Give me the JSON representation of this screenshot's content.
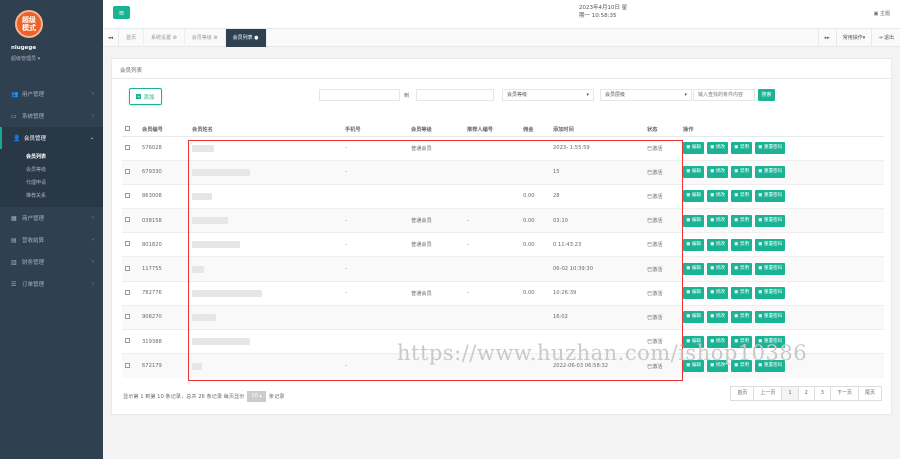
{
  "sidebar": {
    "logo_text": "超级\n模式",
    "user_name": "nlugege",
    "user_role": "超级管理员",
    "items": [
      {
        "icon": "users-icon",
        "glyph": "👥",
        "label": "用户管理"
      },
      {
        "icon": "monitor-icon",
        "glyph": "▭",
        "label": "系统管理"
      },
      {
        "icon": "person-icon",
        "glyph": "👤",
        "label": "会员管理",
        "children": [
          "会员列表",
          "会员等级",
          "代理申请",
          "推荐关系"
        ]
      },
      {
        "icon": "shop-icon",
        "glyph": "▦",
        "label": "商户管理"
      },
      {
        "icon": "chart-icon",
        "glyph": "▤",
        "label": "营收结算"
      },
      {
        "icon": "finance-icon",
        "glyph": "▥",
        "label": "财务管理"
      },
      {
        "icon": "list-icon",
        "glyph": "☰",
        "label": "订单管理"
      }
    ]
  },
  "header": {
    "date": "2023年4月10日 星",
    "time": "期一 10:58:35",
    "theme": "主题"
  },
  "tabs": [
    "首页",
    "系统设置 ⊗",
    "会员等级 ⊗",
    "会员列表 ●"
  ],
  "tab_right": {
    "nav": "▸▸",
    "ops": "常用操作▾",
    "logout": "⇥ 退出"
  },
  "panel": {
    "title": "会员列表",
    "add_label": "添加",
    "to_label": "到",
    "sel1": "会员等级",
    "sel2": "会员层级",
    "search_placeholder": "输入查找的条件内容",
    "search_btn": "搜索"
  },
  "table": {
    "headers": [
      "",
      "会员编号",
      "会员姓名",
      "手机号",
      "会员等级",
      "推荐人编号",
      "佣金",
      "添加时间",
      "状态",
      "操作"
    ],
    "rows": [
      {
        "id": "576028",
        "phone": "-",
        "level": "普通会员",
        "ref": "",
        "comm": "",
        "time": "2023-      1:55:59",
        "status": "已激活"
      },
      {
        "id": "679330",
        "phone": "-",
        "level": "",
        "ref": "",
        "comm": "",
        "time": "15",
        "status": "已激活"
      },
      {
        "id": "863008",
        "phone": "",
        "level": "",
        "ref": "",
        "comm": "0.00",
        "time": "28",
        "status": "已激活"
      },
      {
        "id": "038158",
        "phone": "-",
        "level": "普通会员",
        "ref": "-",
        "comm": "0.00",
        "time": "03:10",
        "status": "已激活"
      },
      {
        "id": "801820",
        "phone": "-",
        "level": "普通会员",
        "ref": "-",
        "comm": "0.00",
        "time": "0 11:43:23",
        "status": "已激活"
      },
      {
        "id": "117755",
        "phone": "-",
        "level": "",
        "ref": "",
        "comm": "",
        "time": "06-02 10:39:30",
        "status": "已激活"
      },
      {
        "id": "782776",
        "phone": "-",
        "level": "普通会员",
        "ref": "-",
        "comm": "0.00",
        "time": "10:26:39",
        "status": "已激活"
      },
      {
        "id": "908270",
        "phone": "",
        "level": "",
        "ref": "",
        "comm": "",
        "time": "16:02",
        "status": "已激活"
      },
      {
        "id": "319388",
        "phone": "",
        "level": "",
        "ref": "",
        "comm": "",
        "time": "",
        "status": "已激活"
      },
      {
        "id": "672179",
        "phone": "-",
        "level": "",
        "ref": "",
        "comm": "",
        "time": "2022-06-03 06:58:32",
        "status": "已激活"
      }
    ],
    "ops": [
      "编辑",
      "修改",
      "禁用",
      "重置密码"
    ]
  },
  "paging": {
    "info": "显示第 1 到第 10 条记录，总共 26 条记录 每页显示",
    "size": "10 ▴",
    "suffix": "条记录",
    "buttons": [
      "首页",
      "上一页",
      "1",
      "2",
      "3",
      "下一页",
      "尾页"
    ]
  },
  "watermark": "https://www.huzhan.com/ishop10386",
  "colors": {
    "accent": "#1ab394",
    "sidebar": "#2f4050",
    "highlight": "#e33333"
  }
}
